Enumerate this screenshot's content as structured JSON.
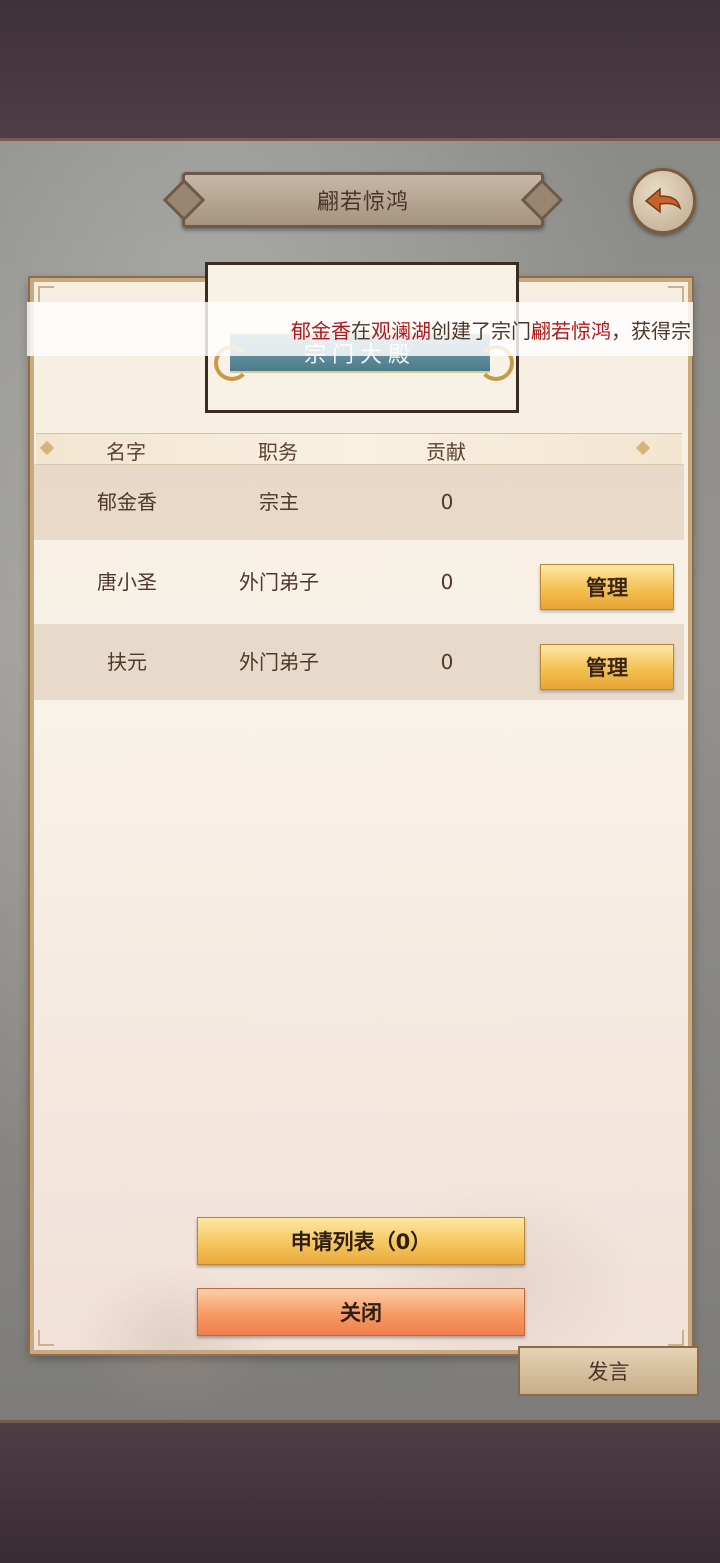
{
  "header": {
    "title": "翩若惊鸿"
  },
  "banner": {
    "text": "宗门大殿"
  },
  "ticker": {
    "segments": [
      {
        "text": "郁金香",
        "color": "#b01818"
      },
      {
        "text": "在",
        "color": "#4e3728"
      },
      {
        "text": "观澜湖",
        "color": "#b01818"
      },
      {
        "text": "创建了宗门",
        "color": "#4e3728"
      },
      {
        "text": "翩若惊鸿",
        "color": "#b01818"
      },
      {
        "text": "，获得宗",
        "color": "#4e3728"
      }
    ]
  },
  "table": {
    "columns": [
      "名字",
      "职务",
      "贡献"
    ],
    "rows": [
      {
        "name": "郁金香",
        "role": "宗主",
        "contribution": "0",
        "action": ""
      },
      {
        "name": "唐小圣",
        "role": "外门弟子",
        "contribution": "0",
        "action": "管理"
      },
      {
        "name": "扶元",
        "role": "外门弟子",
        "contribution": "0",
        "action": "管理"
      }
    ]
  },
  "buttons": {
    "apply_list": "申请列表（0）",
    "close": "关闭",
    "speak": "发言"
  },
  "icons": {
    "back": "back-arrow-icon"
  }
}
